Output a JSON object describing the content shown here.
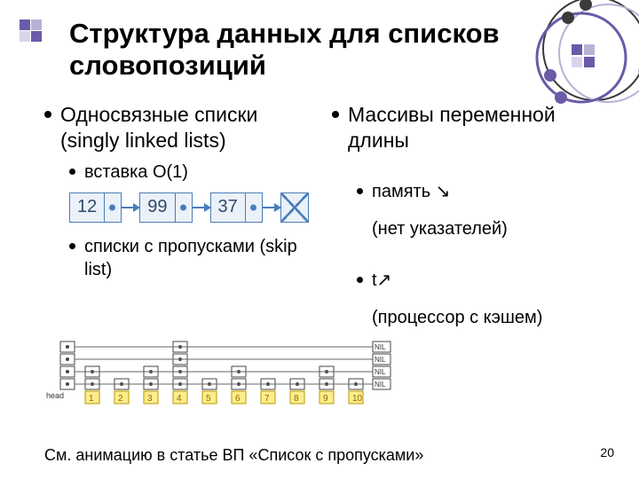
{
  "meta": {
    "slide_number": "20"
  },
  "title": "Структура данных для списков словопозиций",
  "left": {
    "h": "Односвязные списки (singly linked lists)",
    "sub1": "вставка O(1)",
    "linked_values": [
      "12",
      "99",
      "37"
    ],
    "sub2": "списки с пропусками (skip list)",
    "skip_head_label": "head",
    "skip_cells": [
      "1",
      "2",
      "3",
      "4",
      "5",
      "6",
      "7",
      "8",
      "9",
      "10"
    ],
    "skip_nil": "NIL"
  },
  "right": {
    "h": "Массивы переменной длины",
    "sub1": "память ↘",
    "sub1_note": "(нет указателей)",
    "sub2": "t↗",
    "sub2_note": "(процессор с кэшем)"
  },
  "footnote": "См. анимацию в статье ВП «Список с пропусками»"
}
